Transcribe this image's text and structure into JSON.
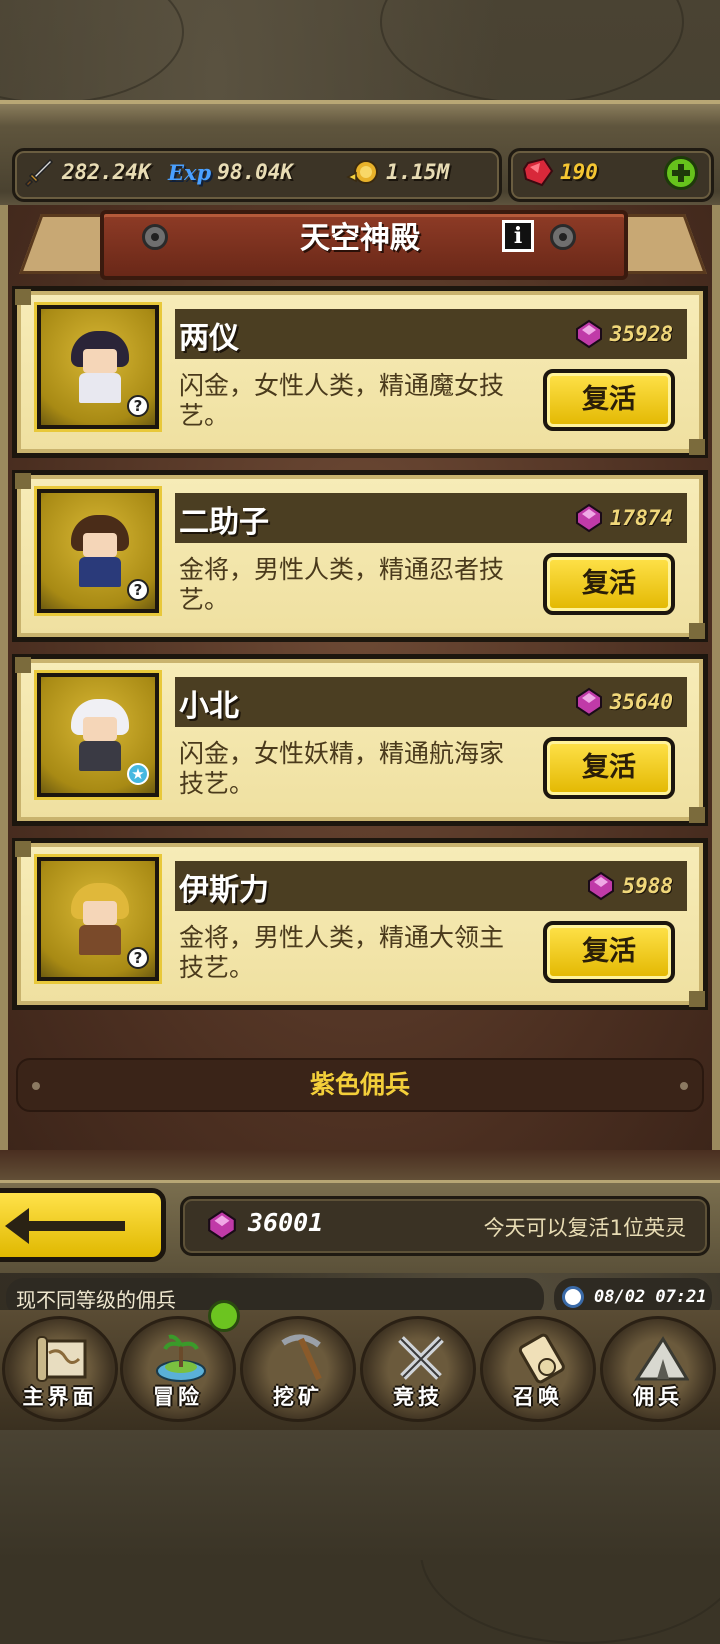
{
  "resources": {
    "attack": "282.24K",
    "exp_icon_label": "Exp",
    "exp": "98.04K",
    "gold": "1.15M",
    "gems": "190"
  },
  "panel": {
    "title": "天空神殿",
    "info_icon": "i"
  },
  "heroes": [
    {
      "name": "两仪",
      "cost": "35928",
      "desc": "闪金，女性人类，精通魔女技艺。",
      "button": "复活",
      "badge": "?"
    },
    {
      "name": "二助子",
      "cost": "17874",
      "desc": "金将，男性人类，精通忍者技艺。",
      "button": "复活",
      "badge": "?"
    },
    {
      "name": "小北",
      "cost": "35640",
      "desc": "闪金，女性妖精，精通航海家技艺。",
      "button": "复活",
      "badge": "★"
    },
    {
      "name": "伊斯力",
      "cost": "5988",
      "desc": "金将，男性人类，精通大领主技艺。",
      "button": "复活",
      "badge": "?"
    }
  ],
  "section": {
    "label": "紫色佣兵"
  },
  "footer": {
    "gem_total": "36001",
    "note": "今天可以复活1位英灵"
  },
  "ticker": {
    "text": "现不同等级的佣兵"
  },
  "clock": {
    "text": "08/02 07:21"
  },
  "nav": [
    {
      "label": "主界面",
      "icon": "map-scroll-icon"
    },
    {
      "label": "冒险",
      "icon": "island-icon"
    },
    {
      "label": "挖矿",
      "icon": "pickaxe-icon"
    },
    {
      "label": "竞技",
      "icon": "crossed-swords-icon"
    },
    {
      "label": "召唤",
      "icon": "summon-scroll-icon"
    },
    {
      "label": "佣兵",
      "icon": "tent-icon"
    }
  ],
  "colors": {
    "gold_button": "#f2c815",
    "card_bg": "#f4e8b0",
    "banner_red": "#8e3b26",
    "gem_purple": "#c03aa8"
  }
}
